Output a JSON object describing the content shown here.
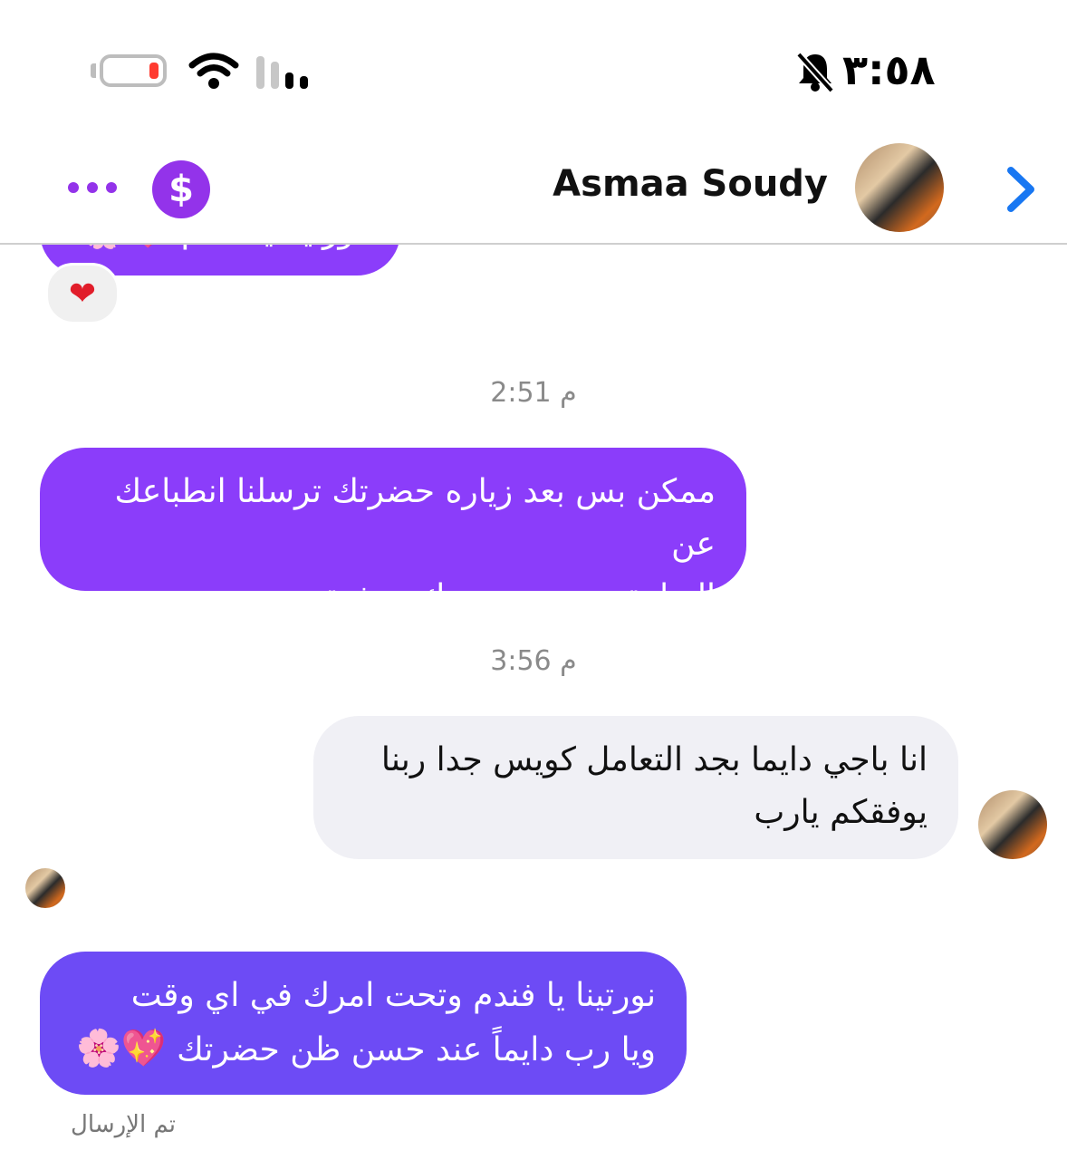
{
  "status_bar": {
    "time": "٣:٥٨"
  },
  "header": {
    "contact_name": "Asmaa Soudy",
    "pay_symbol": "$"
  },
  "messages": [
    {
      "type": "outgoing_partial",
      "text": "نورتينا يا فندم",
      "emojis": "💖🌸",
      "reaction": "❤"
    },
    {
      "type": "timestamp",
      "text": "2:51 م"
    },
    {
      "type": "outgoing",
      "lines": [
        "ممكن بس بعد زياره حضرتك ترسلنا انطباعك عن",
        "الزيارة هنتعب حضرتك معذرة"
      ]
    },
    {
      "type": "timestamp",
      "text": "3:56 م"
    },
    {
      "type": "incoming",
      "lines": [
        "انا باجي دايما بجد التعامل كويس جدا ربنا",
        "يوفقكم يارب"
      ]
    },
    {
      "type": "outgoing",
      "lines": [
        "نورتينا يا فندم وتحت امرك في اي وقت",
        "ويا رب دايماً عند حسن ظن حضرتك"
      ],
      "emojis": "💖🌸"
    }
  ],
  "footer": {
    "sent_status": "تم الإرسال"
  },
  "colors": {
    "accent": "#8b3dfa",
    "back_arrow": "#1877f2",
    "battery_low": "#ff3b30"
  }
}
